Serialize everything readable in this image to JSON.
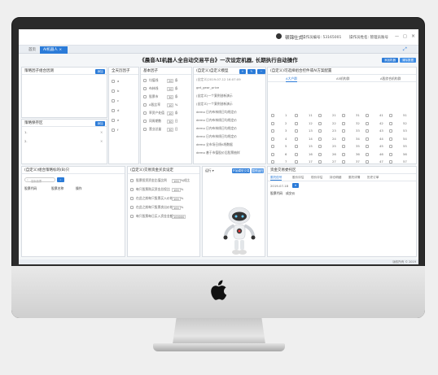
{
  "app": {
    "title": "顿锦仕式",
    "operator_code_label": "操作员编号: 53165001",
    "operator_name_label": "操作员姓名: 管理员账号"
  },
  "tabs": [
    {
      "label": "首页"
    },
    {
      "label": "AI机器人"
    }
  ],
  "headline": "《晨音AI机器人全自动交易平台》一次设定机器, 长期执行自动操作",
  "headline_buttons": {
    "a": "添加机器",
    "b": "清除数据"
  },
  "panels": {
    "strategy": {
      "title": "策略因子组合因测",
      "tag": "添加"
    },
    "strategy_save": {
      "title": "策略保存区",
      "tag": "添加",
      "rows": [
        "1.",
        "2."
      ]
    },
    "history": {
      "title": "全天历因子",
      "rows": [
        "a",
        "b",
        "c",
        "d",
        "e",
        "f"
      ]
    },
    "factor": {
      "title": "基本因子",
      "rows": [
        "均值线",
        "布林线",
        "股票市",
        "A股比率",
        "率资产处值",
        "同周期数",
        "营业总量"
      ],
      "values": [
        "20",
        "20",
        "30",
        "10",
        "10",
        "30",
        "30"
      ],
      "units": [
        "条",
        "条",
        "条",
        "%",
        "条",
        "日",
        "日"
      ]
    },
    "custom_list": {
      "title": "(自定义)自定义模型",
      "items": [
        "(自定义)2019-07-12 16:07:09",
        "get_gear_price",
        "(自定义)一个案例创新演示",
        "(自定义)一个案例创新演示",
        "demo 日内布林线日均线定价",
        "demo 日内布林线日均线定价",
        "demo 日内布林线日均线定价",
        "demo 日内布林线日均线定价",
        "demo 全市场日线K线数据",
        "demo 基于市值股价后股票抽样"
      ]
    },
    "selector": {
      "title": "(自定义)可选择组合控件或AI方案配置",
      "tabs": [
        "A大户群",
        "A5机构群",
        "A股综合机构群"
      ]
    },
    "portfolio": {
      "title": "(自定义)组合策略标的(B)只",
      "search_placeholder": "搜索股票",
      "cols": [
        "股票代码",
        "股票名称",
        "操作"
      ]
    },
    "trade_settings": {
      "title": "(自定义)交易资金买卖设定",
      "rows": [
        "股票投资资金比值比例",
        "每只股票购买资金总投比",
        "在此之前每只股票买入价格",
        "在此之前每只股票卖出价格",
        "每只股票每日买入资金金额"
      ],
      "values": [
        "100",
        "100",
        "100",
        "100",
        "100000"
      ],
      "units": [
        "%成比",
        "%",
        "%",
        "%",
        ""
      ]
    },
    "robot_area": {
      "tag": "运行",
      "btns": [
        "开始模型交易",
        "暂停运行"
      ]
    },
    "signals": {
      "title": "资金交易委托区",
      "tabs": [
        "委托信号",
        "股价评估",
        "现价评估",
        "持仓明细",
        "委托详情",
        "历史订单"
      ],
      "date": "2019-07-18",
      "cols": [
        "股票代码",
        "成交价"
      ]
    }
  },
  "number_grid": [
    [
      1,
      11,
      21,
      31,
      41,
      51
    ],
    [
      2,
      12,
      22,
      32,
      42,
      52
    ],
    [
      3,
      13,
      23,
      33,
      43,
      53
    ],
    [
      4,
      14,
      24,
      34,
      44,
      54
    ],
    [
      5,
      15,
      25,
      35,
      45,
      55
    ],
    [
      6,
      16,
      26,
      36,
      46,
      56
    ],
    [
      7,
      17,
      27,
      37,
      47,
      57
    ],
    [
      8,
      18,
      28,
      38,
      48,
      58
    ],
    [
      9,
      19,
      29,
      39,
      49,
      59
    ],
    [
      10,
      20,
      30,
      40,
      50,
      60
    ]
  ],
  "status_text": "版权所有 © 2019",
  "colors": {
    "accent": "#2b7bd8",
    "bezel": "#2b2b2b"
  }
}
